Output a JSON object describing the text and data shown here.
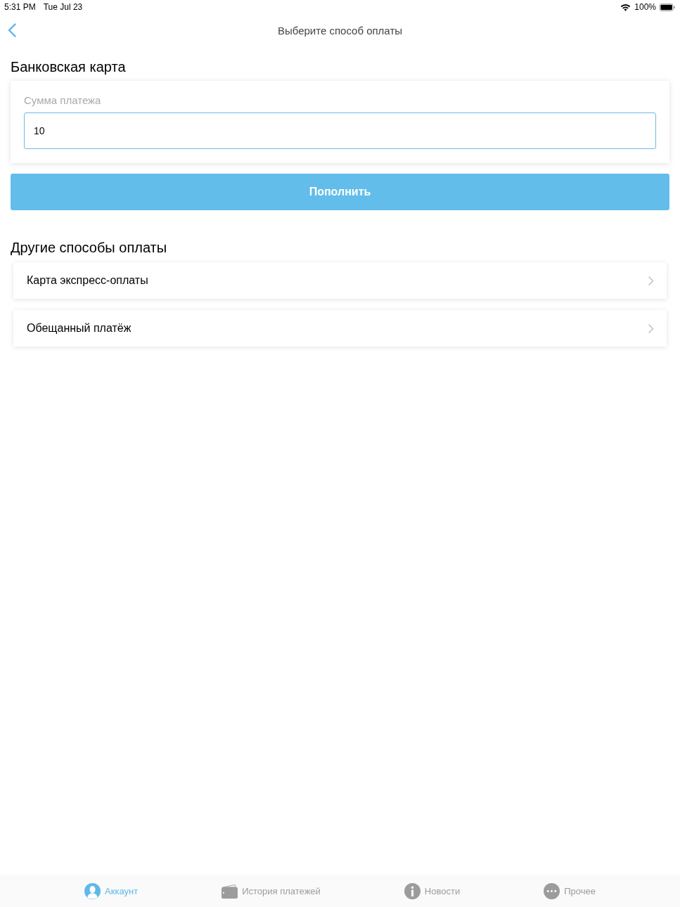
{
  "status_bar": {
    "time": "5:31 PM",
    "date": "Tue Jul 23",
    "battery": "100%"
  },
  "nav_bar": {
    "title": "Выберите способ оплаты"
  },
  "bank_card": {
    "heading": "Банковская карта",
    "amount_field": {
      "label": "Сумма платежа",
      "value": "10"
    },
    "button": "Пополнить"
  },
  "other_methods": {
    "heading": "Другие способы оплаты",
    "items": [
      {
        "label": "Карта экспресс-оплаты"
      },
      {
        "label": "Обещанный платёж"
      }
    ]
  },
  "tab_bar": {
    "tabs": [
      {
        "kind": "account",
        "label": "Аккаунт",
        "selected": true
      },
      {
        "kind": "wallet",
        "label": "История платежей",
        "selected": false
      },
      {
        "kind": "info",
        "label": "Новости",
        "selected": false
      },
      {
        "kind": "more",
        "label": "Прочее",
        "selected": false
      }
    ]
  }
}
